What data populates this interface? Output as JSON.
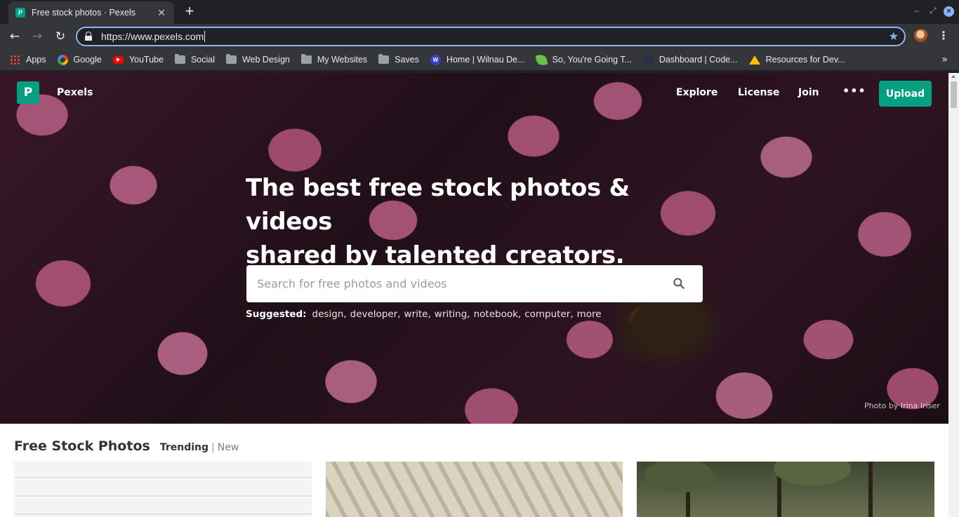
{
  "browser": {
    "tab_title": "Free stock photos · Pexels",
    "tab_favicon_letter": "P",
    "tab_close_glyph": "✕",
    "new_tab_glyph": "+",
    "url": "https://www.pexels.com",
    "bookmarks": [
      {
        "label": "Apps",
        "icon": "apps-icon"
      },
      {
        "label": "Google",
        "icon": "google-icon"
      },
      {
        "label": "YouTube",
        "icon": "youtube-icon"
      },
      {
        "label": "Social",
        "icon": "folder-icon"
      },
      {
        "label": "Web Design",
        "icon": "folder-icon"
      },
      {
        "label": "My Websites",
        "icon": "folder-icon"
      },
      {
        "label": "Saves",
        "icon": "folder-icon"
      },
      {
        "label": "Home | Wilnau De...",
        "icon": "wilnau-icon"
      },
      {
        "label": "So, You're Going T...",
        "icon": "leaf-icon"
      },
      {
        "label": "Dashboard | Code...",
        "icon": "codepen-icon"
      },
      {
        "label": "Resources for Dev...",
        "icon": "drive-icon"
      }
    ],
    "bookmarks_overflow": "»"
  },
  "site": {
    "logo_letter": "P",
    "logo_text": "Pexels",
    "nav": {
      "explore": "Explore",
      "license": "License",
      "join": "Join",
      "more": "•••",
      "upload": "Upload"
    },
    "headline_line1": "The best free stock photos & videos",
    "headline_line2": "shared by talented creators.",
    "search": {
      "placeholder": "Search for free photos and videos",
      "value": ""
    },
    "suggested_label": "Suggested:",
    "suggestions": [
      "design",
      "developer",
      "write",
      "writing",
      "notebook",
      "computer",
      "more"
    ],
    "photo_credit": "Photo by Irina Iriser",
    "section_title": "Free Stock Photos",
    "tabs": {
      "trending": "Trending",
      "separator": "|",
      "new": "New"
    }
  },
  "colors": {
    "brand_green": "#05a081",
    "chrome_dark": "#202124",
    "chrome_toolbar": "#35363a",
    "omnibox_focus": "#8ab4f8"
  }
}
